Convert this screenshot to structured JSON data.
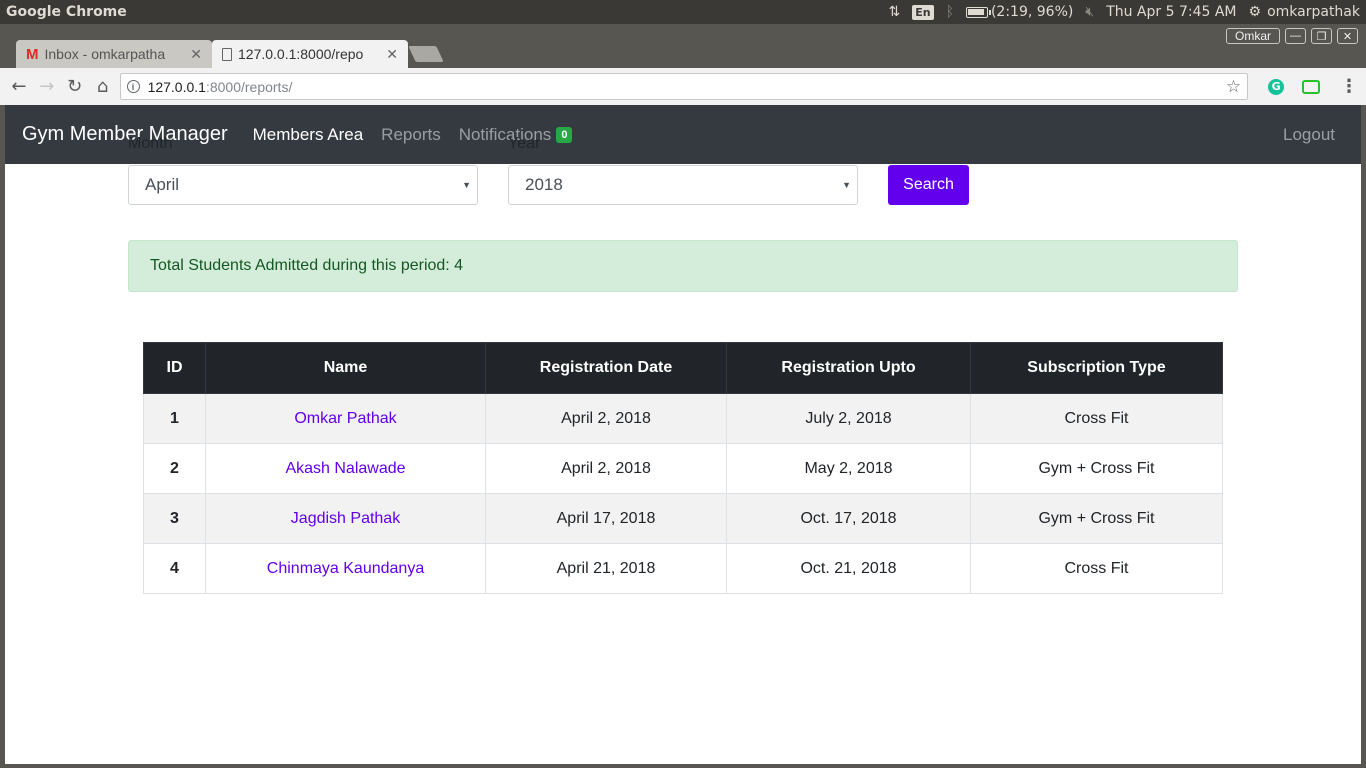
{
  "os": {
    "app_name": "Google Chrome",
    "lang": "En",
    "battery": "(2:19, 96%)",
    "battery_level": 0.96,
    "datetime": "Thu Apr  5  7:45 AM",
    "user": "omkarpathak"
  },
  "browser": {
    "tabs": [
      {
        "title": "Inbox - omkarpatha",
        "icon": "gmail-icon"
      },
      {
        "title": "127.0.0.1:8000/repo",
        "icon": "page-icon"
      }
    ],
    "profile": "Omkar",
    "url_host": "127.0.0.1",
    "url_rest": ":8000/reports/"
  },
  "navbar": {
    "brand": "Gym Member Manager",
    "links": [
      "Members Area",
      "Reports",
      "Notifications"
    ],
    "notifications_count": "0",
    "logout": "Logout"
  },
  "filter": {
    "month_label": "Month",
    "month_value": "April",
    "year_label": "Year",
    "year_value": "2018",
    "search_label": "Search"
  },
  "summary": "Total Students Admitted during this period: 4",
  "table": {
    "headers": [
      "ID",
      "Name",
      "Registration Date",
      "Registration Upto",
      "Subscription Type"
    ],
    "rows": [
      {
        "id": "1",
        "name": "Omkar Pathak",
        "reg_date": "April 2, 2018",
        "reg_upto": "July 2, 2018",
        "type": "Cross Fit"
      },
      {
        "id": "2",
        "name": "Akash Nalawade",
        "reg_date": "April 2, 2018",
        "reg_upto": "May 2, 2018",
        "type": "Gym + Cross Fit"
      },
      {
        "id": "3",
        "name": "Jagdish Pathak",
        "reg_date": "April 17, 2018",
        "reg_upto": "Oct. 17, 2018",
        "type": "Gym + Cross Fit"
      },
      {
        "id": "4",
        "name": "Chinmaya Kaundanya",
        "reg_date": "April 21, 2018",
        "reg_upto": "Oct. 21, 2018",
        "type": "Cross Fit"
      }
    ]
  },
  "colors": {
    "accent": "#6200ee",
    "navbar_bg": "#343a40",
    "alert_bg": "#d4edda",
    "badge": "#28a745"
  }
}
